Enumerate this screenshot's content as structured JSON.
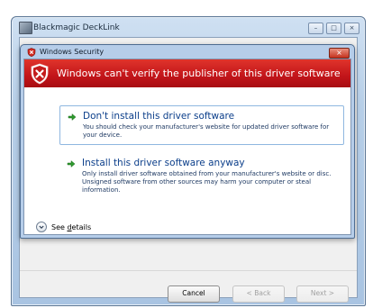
{
  "outer_window": {
    "title": "Blackmagic DeckLink",
    "cancel_label": "Cancel",
    "back_label": "< Back",
    "next_label": "Next >"
  },
  "dialog": {
    "title": "Windows Security",
    "banner_text": "Windows can't verify the publisher of this driver software",
    "options": [
      {
        "title": "Don't install this driver software",
        "description": "You should check your manufacturer's website for updated driver software for your device."
      },
      {
        "title": "Install this driver software anyway",
        "description": "Only install driver software obtained from your manufacturer's website or disc. Unsigned software from other sources may harm your computer or steal information."
      }
    ],
    "see_details_prefix": "See ",
    "see_details_underlined": "d",
    "see_details_suffix": "etails"
  },
  "colors": {
    "banner_red": "#c2151a",
    "link_blue": "#0b3e8a",
    "arrow_green": "#2e9a2e"
  }
}
